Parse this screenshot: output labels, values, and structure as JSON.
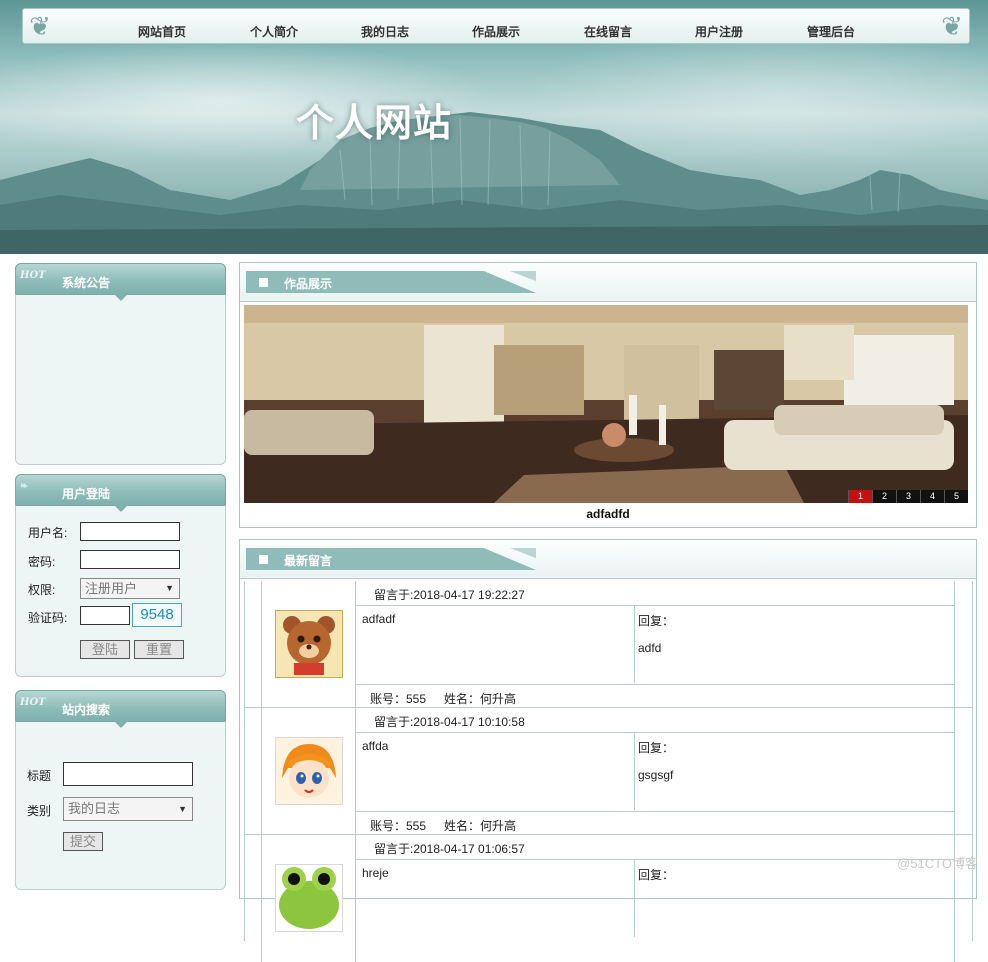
{
  "nav": {
    "items": [
      "网站首页",
      "个人简介",
      "我的日志",
      "作品展示",
      "在线留言",
      "用户注册",
      "管理后台"
    ]
  },
  "banner": {
    "title": "个人网站"
  },
  "sidebar": {
    "notice": {
      "badge": "HOT",
      "title": "系统公告"
    },
    "login": {
      "title": "用户登陆",
      "username_label": "用户名:",
      "password_label": "密码:",
      "role_label": "权限:",
      "role_value": "注册用户",
      "captcha_label": "验证码:",
      "captcha_value": "9548",
      "login_button": "登陆",
      "reset_button": "重置"
    },
    "search": {
      "badge": "HOT",
      "title": "站内搜索",
      "title_label": "标题",
      "category_label": "类别",
      "category_value": "我的日志",
      "submit_button": "提交"
    }
  },
  "works": {
    "title": "作品展示",
    "caption": "adfadfd",
    "pages": [
      "1",
      "2",
      "3",
      "4",
      "5"
    ],
    "active_page": "1"
  },
  "messages": {
    "title": "最新留言",
    "reply_label": "回复：",
    "items": [
      {
        "time": "留言于:2018-04-17 19:22:27",
        "content": "adfadf",
        "reply": "adfd",
        "account": "账号：555",
        "name": "姓名：何升高",
        "avatar_icon": "bear-avatar-icon"
      },
      {
        "time": "留言于:2018-04-17 10:10:58",
        "content": "affda",
        "reply": "gsgsgf",
        "account": "账号：555",
        "name": "姓名：何升高",
        "avatar_icon": "anime-girl-avatar-icon"
      },
      {
        "time": "留言于:2018-04-17 01:06:57",
        "content": "hreje",
        "reply": "",
        "account": "",
        "name": "",
        "avatar_icon": "frog-avatar-icon"
      }
    ]
  },
  "watermark": "@51CTO博客",
  "colors": {
    "accent": "#8fbbb8",
    "border": "#a9c7c5",
    "active_page": "#c60f0f"
  }
}
